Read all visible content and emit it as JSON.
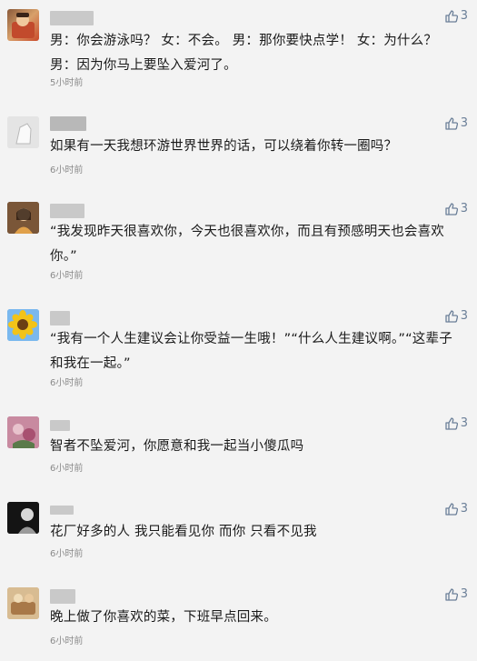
{
  "comments": [
    {
      "text": "男：你会游泳吗？ 女：不会。 男：那你要快点学！ 女：为什么？ 男：因为你马上要坠入爱河了。",
      "time": "5小时前",
      "likes": "3",
      "avatar": "avatar-icon"
    },
    {
      "text": "如果有一天我想环游世界世界的话，可以绕着你转一圈吗？",
      "time": "6小时前",
      "likes": "3",
      "avatar": "avatar-icon"
    },
    {
      "text": "“我发现昨天很喜欢你，今天也很喜欢你，而且有预感明天也会喜欢你。”",
      "time": "6小时前",
      "likes": "3",
      "avatar": "avatar-icon"
    },
    {
      "text": "“我有一个人生建议会让你受益一生哦！”“什么人生建议啊。”“这辈子和我在一起。”",
      "time": "6小时前",
      "likes": "3",
      "avatar": "avatar-icon"
    },
    {
      "text": "智者不坠爱河，你愿意和我一起当小傻瓜吗",
      "time": "6小时前",
      "likes": "3",
      "avatar": "avatar-icon"
    },
    {
      "text": "花厂好多的人 我只能看见你 而你 只看不见我",
      "time": "6小时前",
      "likes": "3",
      "avatar": "avatar-icon"
    },
    {
      "text": "晚上做了你喜欢的菜，下班早点回来。",
      "time": "6小时前",
      "likes": "3",
      "avatar": "avatar-icon"
    }
  ],
  "colors": {
    "like": "#6b7f98",
    "time": "#8a8a8a",
    "background": "#f3f3f3"
  },
  "icons": {
    "like": "thumbs-up-icon"
  }
}
